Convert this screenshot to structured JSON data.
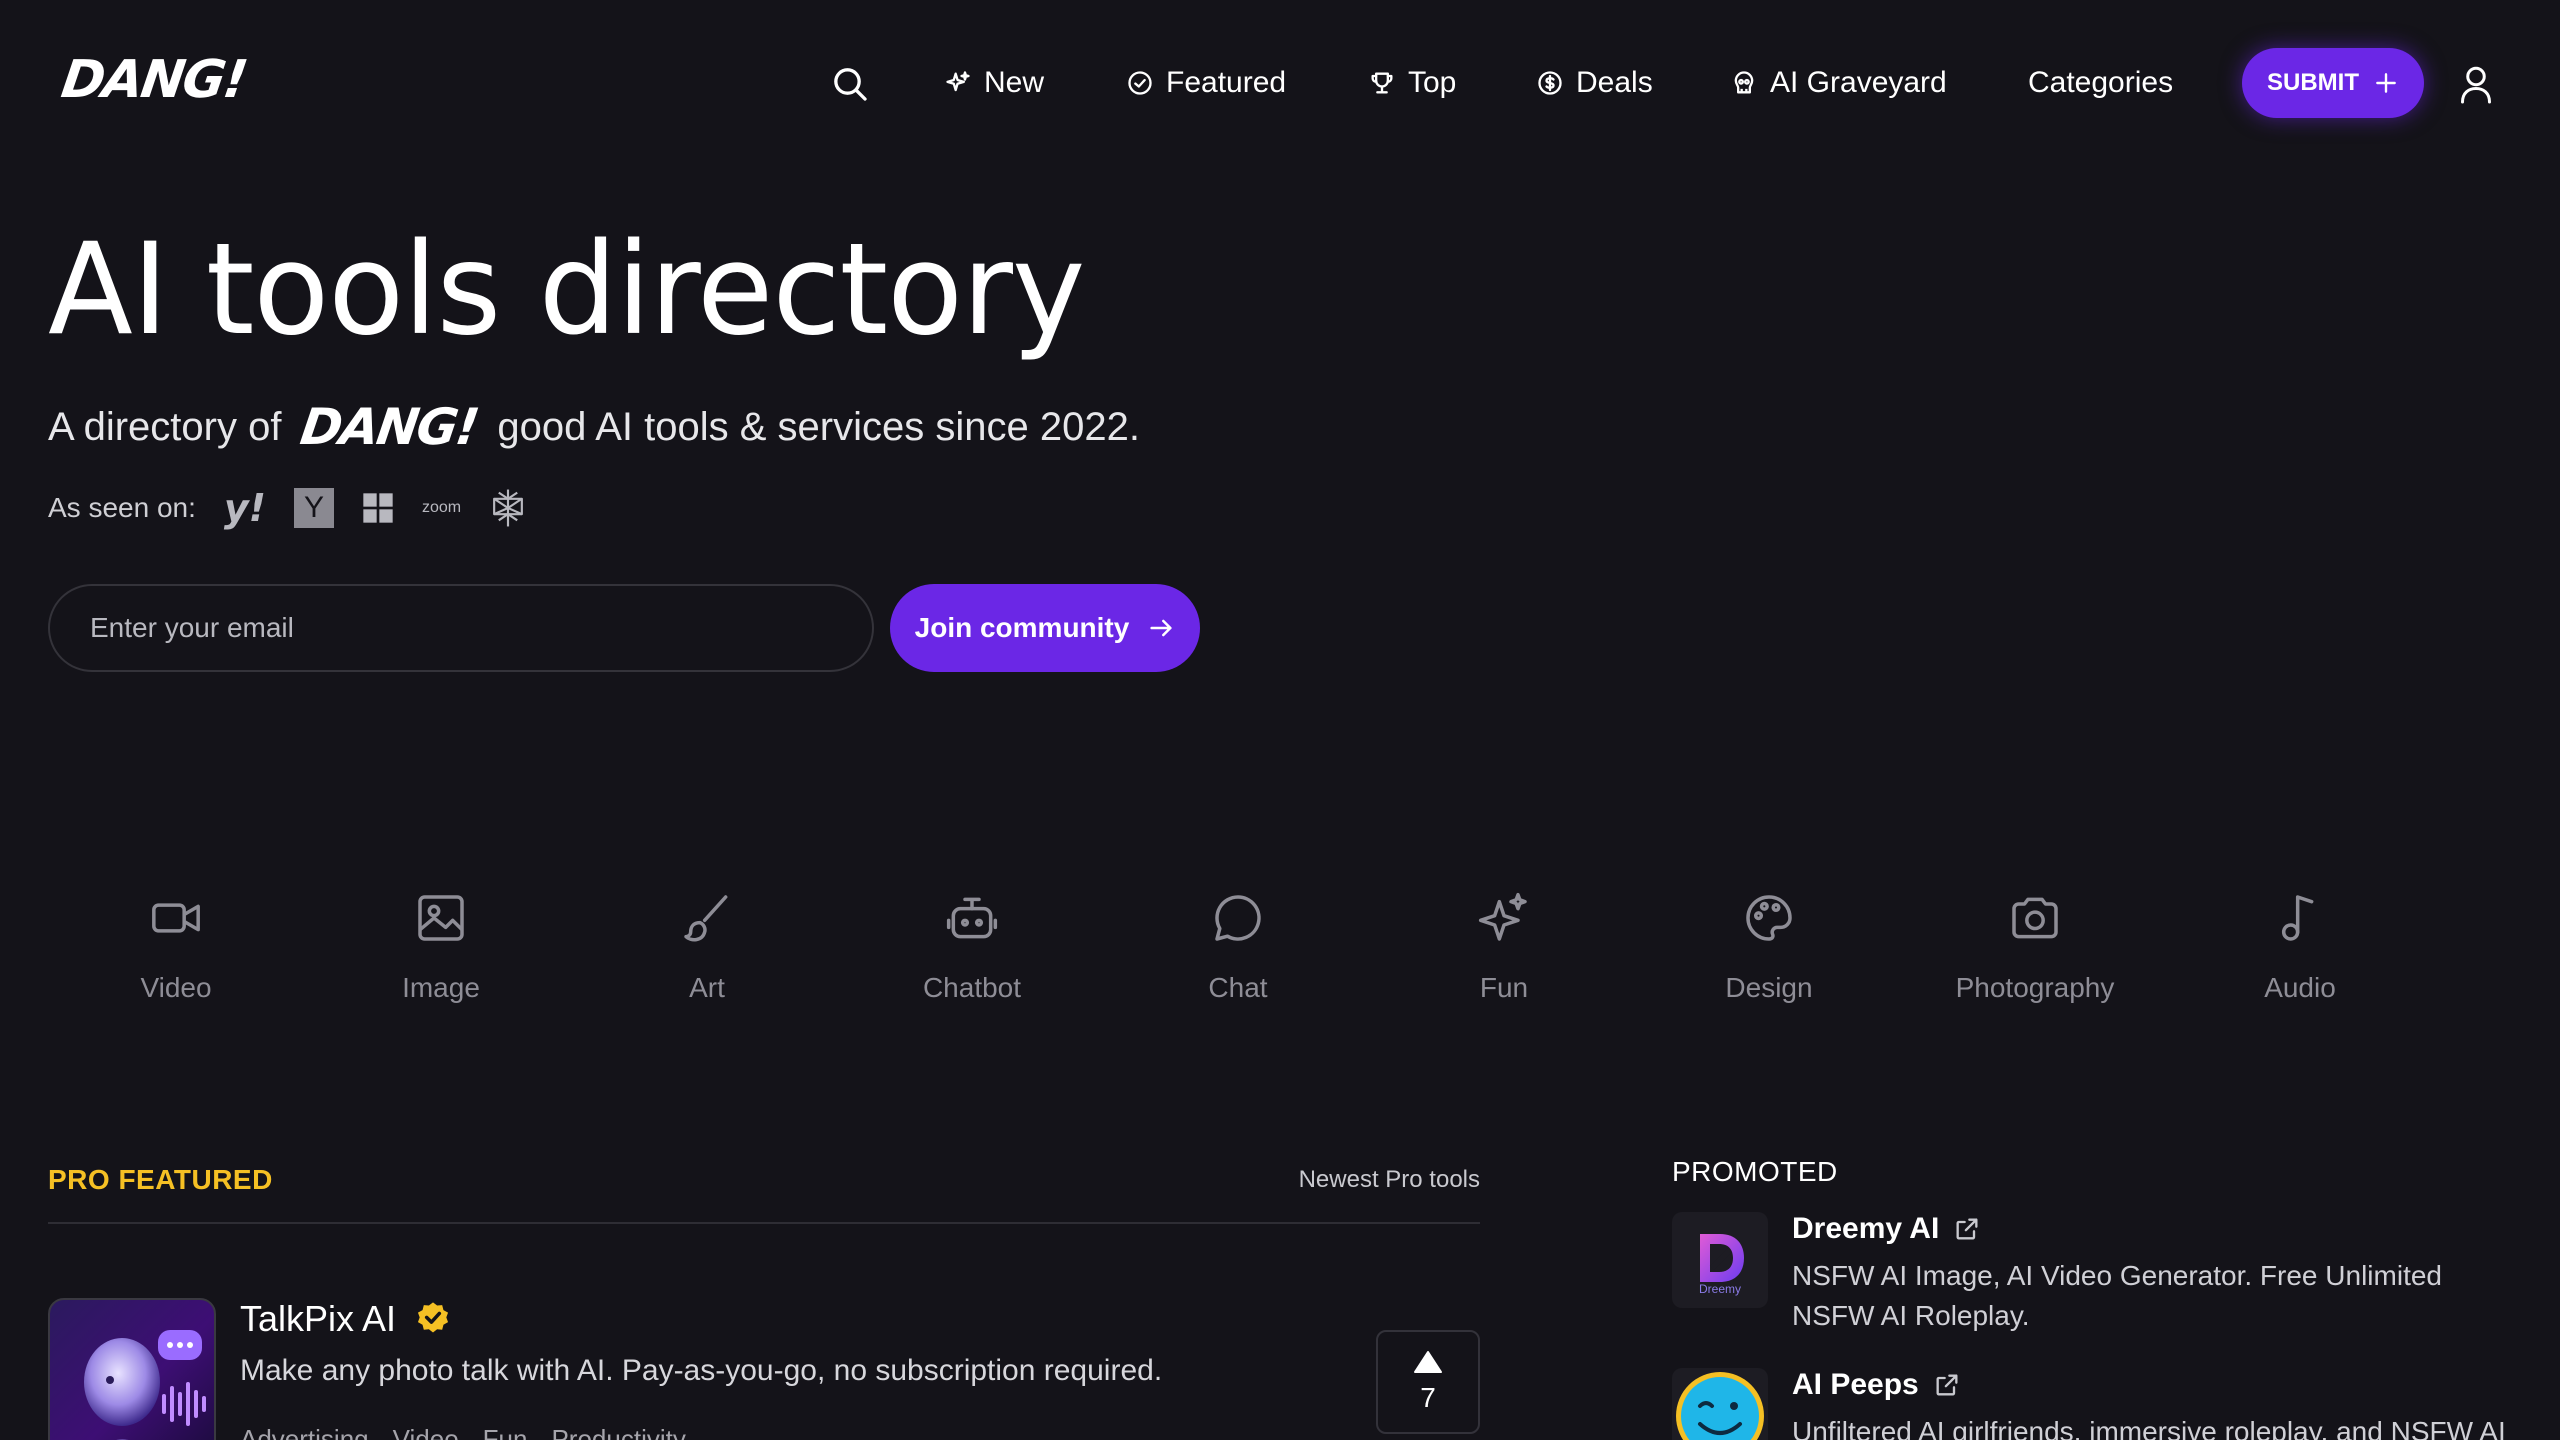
{
  "brand": {
    "logo_text": "DANG!"
  },
  "nav": {
    "items": [
      {
        "label": "New",
        "icon": "sparkle-icon"
      },
      {
        "label": "Featured",
        "icon": "badge-check-icon"
      },
      {
        "label": "Top",
        "icon": "trophy-icon"
      },
      {
        "label": "Deals",
        "icon": "dollar-circle-icon"
      },
      {
        "label": "AI Graveyard",
        "icon": "skull-icon"
      },
      {
        "label": "Categories",
        "icon": ""
      }
    ],
    "submit_label": "SUBMIT"
  },
  "hero": {
    "title": "AI tools directory",
    "sub_before": "A directory of",
    "sub_logo": "DANG!",
    "sub_after": "good AI tools & services since 2022.",
    "seen_on_label": "As seen on:",
    "seen_on_brands": [
      "y!",
      "Y",
      "windows",
      "zoom",
      "perplexity"
    ],
    "email_placeholder": "Enter your email",
    "join_label": "Join community"
  },
  "categories": [
    {
      "label": "Video",
      "icon": "video-camera-icon"
    },
    {
      "label": "Image",
      "icon": "image-icon"
    },
    {
      "label": "Art",
      "icon": "brush-icon"
    },
    {
      "label": "Chatbot",
      "icon": "robot-icon"
    },
    {
      "label": "Chat",
      "icon": "chat-bubble-icon"
    },
    {
      "label": "Fun",
      "icon": "sparkles-icon"
    },
    {
      "label": "Design",
      "icon": "palette-icon"
    },
    {
      "label": "Photography",
      "icon": "camera-icon"
    },
    {
      "label": "Audio",
      "icon": "music-note-icon"
    }
  ],
  "pro_featured": {
    "title": "PRO FEATURED",
    "newest_link": "Newest Pro tools",
    "tool": {
      "name": "TalkPix AI",
      "description": "Make any photo talk with AI. Pay-as-you-go, no subscription required.",
      "tags": [
        "Advertising",
        "Video",
        "Fun",
        "Productivity"
      ],
      "votes": "7"
    }
  },
  "promoted": {
    "title": "PROMOTED",
    "items": [
      {
        "name": "Dreemy AI",
        "description": "NSFW AI Image, AI Video Generator. Free Unlimited NSFW AI Roleplay.",
        "thumb_text": "Dreemy"
      },
      {
        "name": "AI Peeps",
        "description": "Unfiltered AI girlfriends, immersive roleplay, and NSFW AI"
      }
    ]
  },
  "colors": {
    "accent": "#6b27e6",
    "pro": "#f5c024",
    "bg": "#141319"
  }
}
